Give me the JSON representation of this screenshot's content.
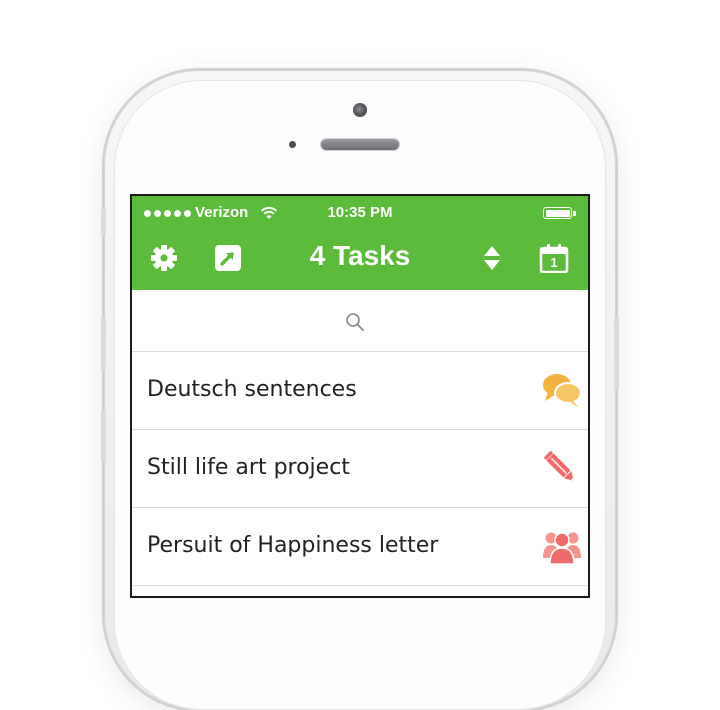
{
  "status_bar": {
    "carrier": "Verizon",
    "time": "10:35 PM"
  },
  "header": {
    "title": "4 Tasks",
    "background_color": "#5dbb3c"
  },
  "search": {
    "icon": "search-icon"
  },
  "tasks": [
    {
      "label": "Deutsch sentences",
      "icon": "chat-bubbles-icon",
      "icon_color": "#f2b43f"
    },
    {
      "label": "Still life art project",
      "icon": "pencil-icon",
      "icon_color": "#f26b6b"
    },
    {
      "label": "Persuit of Happiness letter",
      "icon": "group-icon",
      "icon_color": "#f26b6b"
    }
  ],
  "calendar_day": "1"
}
